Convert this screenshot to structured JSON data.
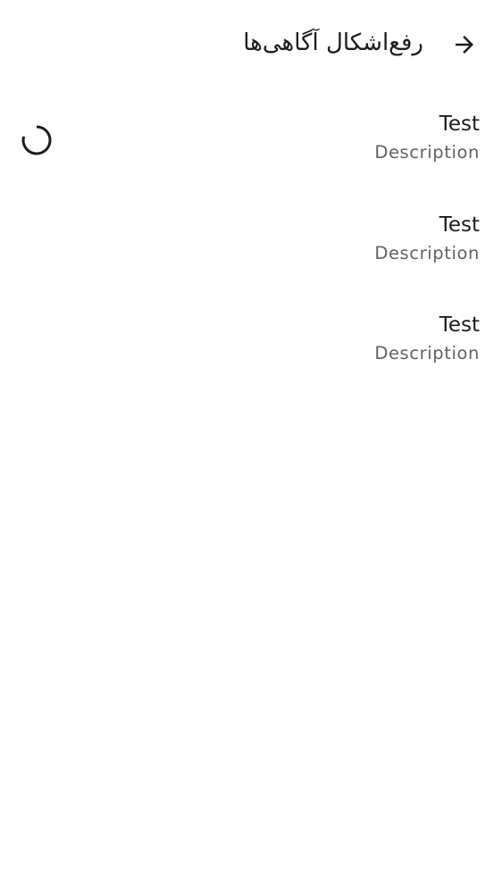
{
  "app_bar": {
    "title": "رفع‌اشکال آگاهی‌ها",
    "back_icon": "arrow-forward-icon"
  },
  "list": {
    "items": [
      {
        "title": "Test",
        "description": "Description",
        "loading": true
      },
      {
        "title": "Test",
        "description": "Description",
        "loading": false
      },
      {
        "title": "Test",
        "description": "Description",
        "loading": false
      }
    ]
  },
  "colors": {
    "text_primary": "#1d1b20",
    "text_secondary": "#5f6368",
    "background": "#ffffff"
  }
}
